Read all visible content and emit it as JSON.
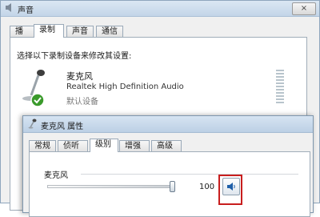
{
  "sound_window": {
    "title": "声音",
    "close": "×",
    "tabs": [
      "播放",
      "录制",
      "声音",
      "通信"
    ],
    "active_tab": "录制",
    "instruction": "选择以下录制设备来修改其设置:",
    "device": {
      "name": "麦克风",
      "description": "Realtek High Definition Audio",
      "status": "默认设备"
    }
  },
  "properties_window": {
    "title": "麦克风 属性",
    "tabs": [
      "常规",
      "侦听",
      "级别",
      "增强",
      "高级"
    ],
    "active_tab": "级别",
    "group_label": "麦克风",
    "volume": {
      "value": "100",
      "level": 1.0
    }
  },
  "colors": {
    "highlight": "#c81e1e",
    "status_check": "#3a9a2b"
  },
  "icons": [
    "sound-icon",
    "microphone-icon",
    "check-icon",
    "speaker-icon"
  ]
}
